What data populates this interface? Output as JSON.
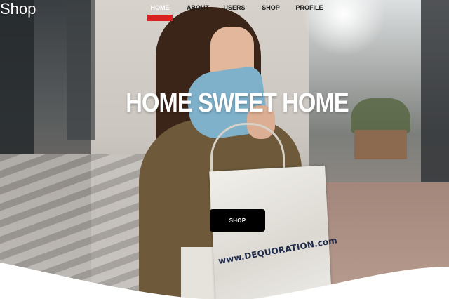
{
  "brand": {
    "name": "Shop"
  },
  "nav": {
    "items": [
      {
        "label": "HOME",
        "active": true
      },
      {
        "label": "ABOUT",
        "active": false
      },
      {
        "label": "USERS",
        "active": false
      },
      {
        "label": "SHOP",
        "active": false
      },
      {
        "label": "PROFILE",
        "active": false
      }
    ]
  },
  "hero": {
    "title": "HOME SWEET HOME",
    "cta_label": "SHOP",
    "bag_print": "www.DEQUORATION.com"
  },
  "colors": {
    "accent": "#d9221f",
    "button_bg": "#000000",
    "title_text": "#ffffff"
  }
}
